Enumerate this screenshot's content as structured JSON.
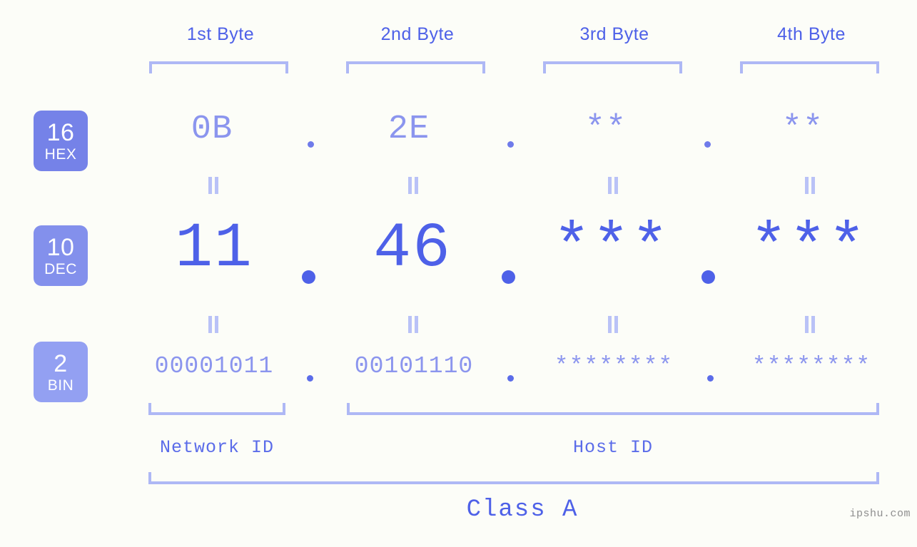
{
  "site": {
    "watermark": "ipshu.com"
  },
  "byte_headers": [
    {
      "label": "1st Byte"
    },
    {
      "label": "2nd Byte"
    },
    {
      "label": "3rd Byte"
    },
    {
      "label": "4th Byte"
    }
  ],
  "radix_badges": [
    {
      "num": "16",
      "tag": "HEX",
      "color": "#7582e8"
    },
    {
      "num": "10",
      "tag": "DEC",
      "color": "#8390ec"
    },
    {
      "num": "2",
      "tag": "BIN",
      "color": "#93a0f2"
    }
  ],
  "rows": {
    "hex": {
      "values": [
        "0B",
        "2E",
        "**",
        "**"
      ]
    },
    "dec": {
      "values": [
        "11",
        "46",
        "***",
        "***"
      ]
    },
    "bin": {
      "values": [
        "00001011",
        "00101110",
        "********",
        "********"
      ]
    }
  },
  "separators": {
    "hex": [
      ".",
      ".",
      "."
    ],
    "dec": [
      ".",
      ".",
      "."
    ],
    "bin": [
      ".",
      ".",
      "."
    ]
  },
  "equals_glyph": "=",
  "sections": [
    {
      "label": "Network ID"
    },
    {
      "label": "Host ID"
    }
  ],
  "class": {
    "label": "Class A"
  },
  "colors": {
    "background": "#fcfdf8",
    "accent_strong": "#4e61e8",
    "accent_light": "#8b95ee",
    "bracket": "#aeb8f5",
    "equals": "#b9c2f7",
    "watermark": "#8e8e8e"
  }
}
